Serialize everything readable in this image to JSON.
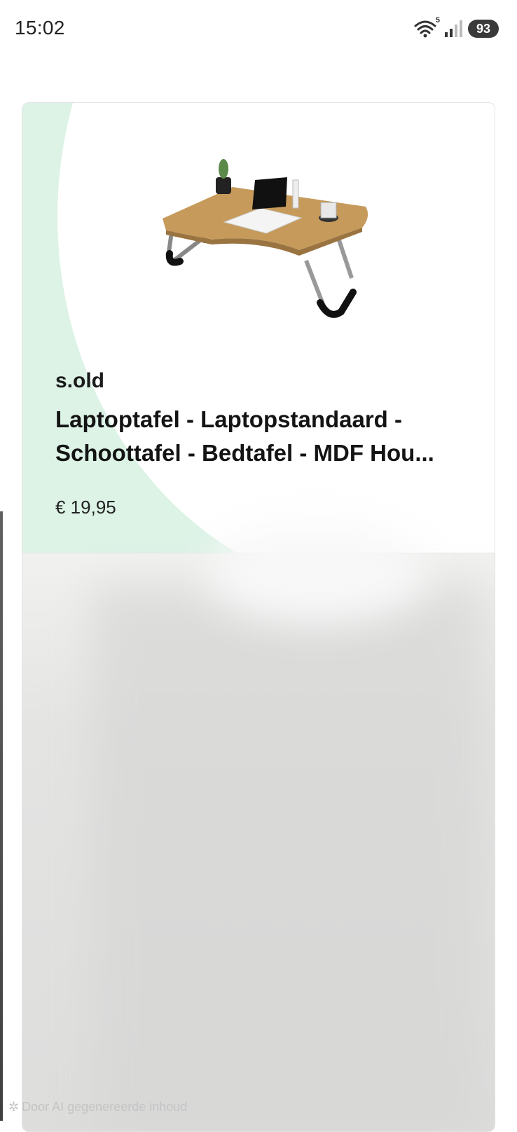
{
  "status_bar": {
    "time": "15:02",
    "wifi_badge": "5",
    "battery": "93",
    "icons": [
      "wifi-icon",
      "signal-icon",
      "battery-icon"
    ]
  },
  "product": {
    "seller": "s.old",
    "title": "Laptoptafel - Laptopstandaard -\nSchoottafel - Bedtafel - MDF Hou...",
    "price": "€ 19,95",
    "image": "laptop-table-image"
  },
  "footer": {
    "ai_label": "Door AI gegenereerde inhoud"
  },
  "colors": {
    "card_accent": "#dcf3e6",
    "text": "#141414"
  }
}
